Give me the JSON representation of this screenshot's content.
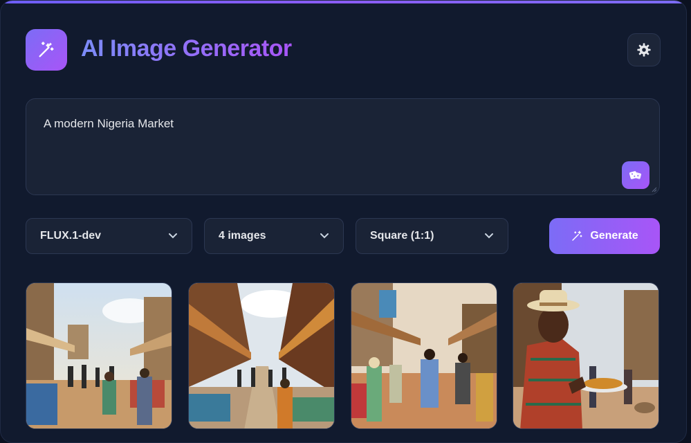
{
  "app": {
    "title": "AI Image Generator"
  },
  "header": {
    "logo_icon": "magic-wand-icon",
    "settings_icon": "gear-icon"
  },
  "prompt": {
    "value": "A modern Nigeria Market",
    "random_icon": "dice-icon"
  },
  "controls": {
    "model": {
      "selected": "FLUX.1-dev"
    },
    "count": {
      "selected": "4 images"
    },
    "aspect": {
      "selected": "Square (1:1)"
    },
    "generate_label": "Generate"
  },
  "gallery": {
    "images": [
      {
        "subject": "market street with awnings and shoppers"
      },
      {
        "subject": "covered market lane with stalls"
      },
      {
        "subject": "dusty market road with walking people"
      },
      {
        "subject": "man in straw hat holding a plate of food"
      }
    ]
  },
  "colors": {
    "accent_start": "#7c6cf6",
    "accent_end": "#a855f7",
    "panel": "#111a2e",
    "field": "#1a2336"
  }
}
